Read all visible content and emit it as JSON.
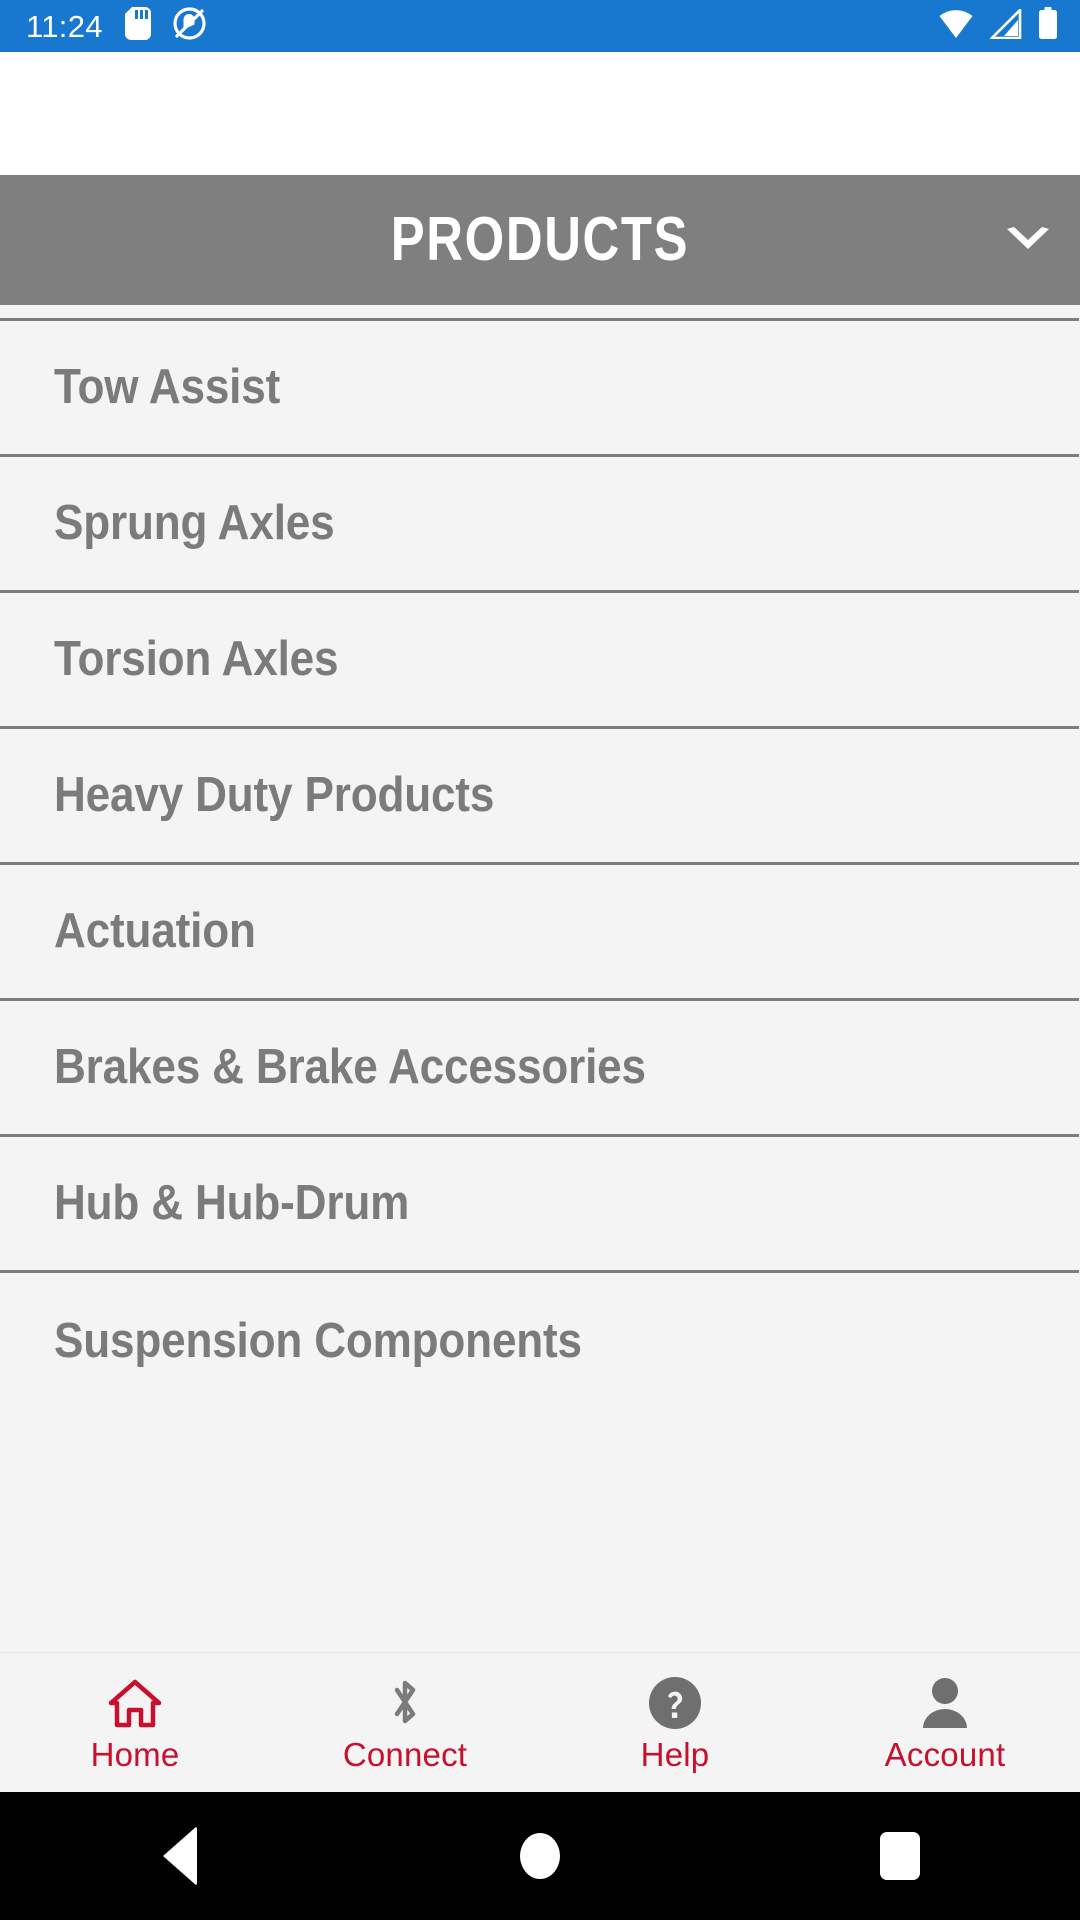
{
  "status_bar": {
    "time": "11:24",
    "left_icons": [
      "sd-card-icon",
      "do-not-disturb-icon"
    ],
    "right_icons": [
      "wifi-icon",
      "cellular-signal-icon",
      "battery-icon"
    ],
    "background_color": "#1877cf",
    "foreground_color": "#ffffff"
  },
  "section_header": {
    "title": "PRODUCTS",
    "expand_icon": "chevron-down-icon",
    "background_color": "#7f7f7f",
    "text_color": "#ffffff"
  },
  "product_list": {
    "row_background_color": "#f4f4f4",
    "divider_color": "#7d7d7d",
    "text_color": "#7b7b7b",
    "items": [
      {
        "label": "Tow Assist"
      },
      {
        "label": "Sprung Axles"
      },
      {
        "label": "Torsion Axles"
      },
      {
        "label": "Heavy Duty Products"
      },
      {
        "label": "Actuation"
      },
      {
        "label": "Brakes & Brake Accessories"
      },
      {
        "label": "Hub & Hub-Drum"
      },
      {
        "label": "Suspension Components"
      }
    ]
  },
  "tab_bar": {
    "background_color": "#f4f4f4",
    "label_color": "#c8102e",
    "tabs": [
      {
        "label": "Home",
        "icon": "home-icon",
        "icon_color": "#c8102e"
      },
      {
        "label": "Connect",
        "icon": "bluetooth-icon",
        "icon_color": "#7b7b7b"
      },
      {
        "label": "Help",
        "icon": "help-circle-icon",
        "icon_color": "#7b7b7b"
      },
      {
        "label": "Account",
        "icon": "person-icon",
        "icon_color": "#7b7b7b"
      }
    ]
  },
  "android_nav_bar": {
    "background_color": "#000000",
    "buttons": [
      {
        "name": "back-button"
      },
      {
        "name": "home-button"
      },
      {
        "name": "recents-button"
      }
    ]
  }
}
